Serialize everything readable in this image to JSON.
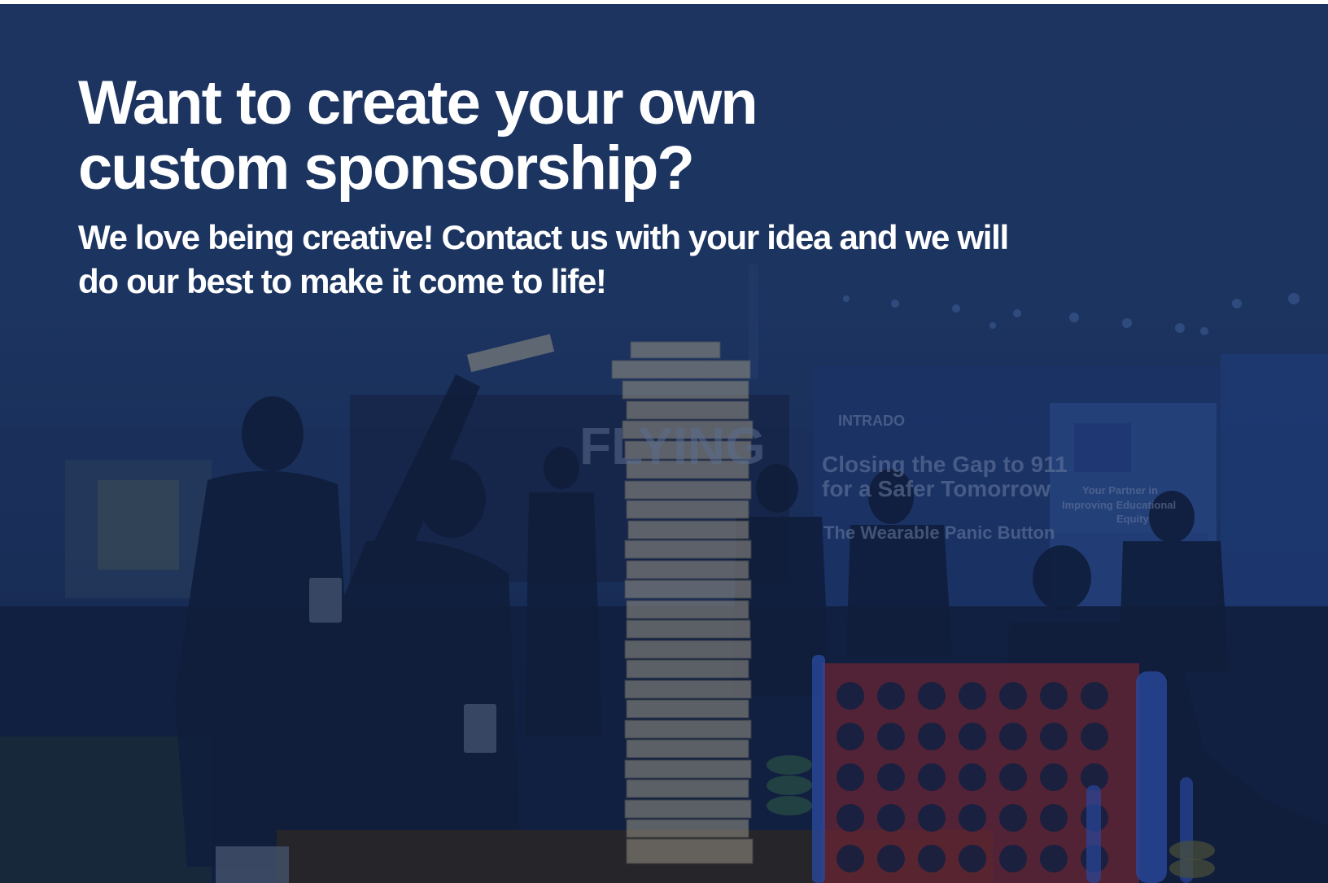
{
  "hero": {
    "headline_lines": [
      "Want to create your own",
      "custom sponsorship?"
    ],
    "subtext_lines": [
      "We love being creative! Contact us with your idea and we will",
      "do our best to make it come to life!"
    ]
  },
  "photo": {
    "booth_banners": [
      {
        "text": "FLYING"
      },
      {
        "text": "INTRADO"
      },
      {
        "text": "Closing the Gap to 911"
      },
      {
        "text": "for a Safer Tomorrow"
      },
      {
        "text": "The Wearable Panic Button"
      },
      {
        "text": "Your Partner in"
      },
      {
        "text": "Improving Educational"
      },
      {
        "text": "Equity"
      }
    ]
  },
  "colors": {
    "overlay_navy": "#1c3561",
    "headline_white": "#ffffff",
    "jenga_wood": "#b8ab8d",
    "connect_four_red": "#8a1f23",
    "connect_four_blue": "#2d4fb0"
  }
}
